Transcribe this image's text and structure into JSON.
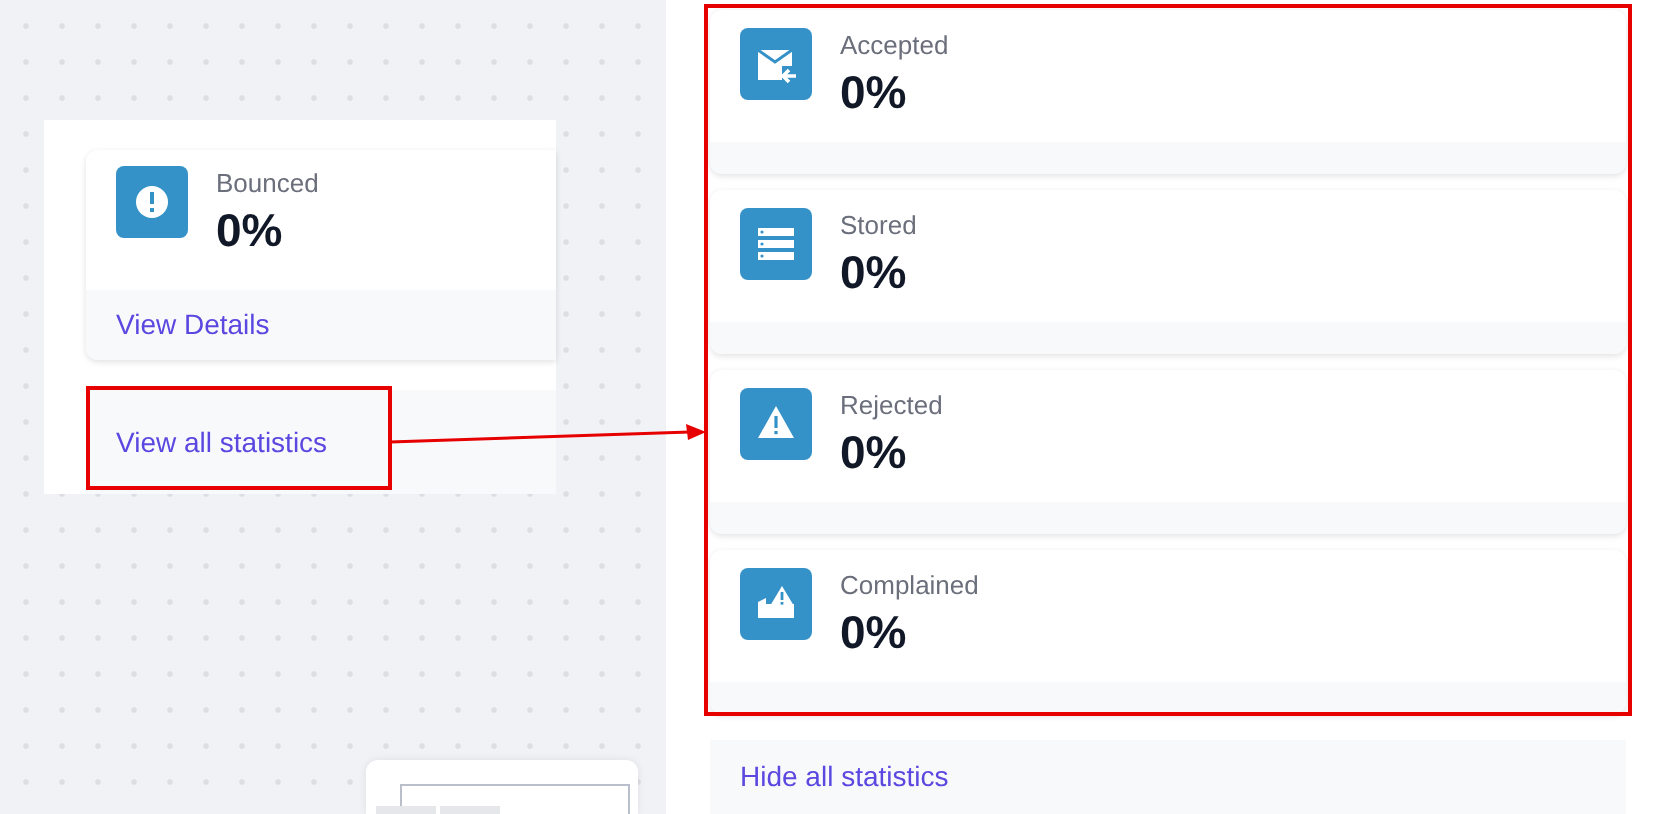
{
  "left_panel": {
    "card": {
      "kind": "bounced",
      "label": "Bounced",
      "value": "0%",
      "link": "View Details"
    },
    "link": "View all statistics"
  },
  "right_panel": {
    "cards": [
      {
        "kind": "accepted",
        "label": "Accepted",
        "value": "0%"
      },
      {
        "kind": "stored",
        "label": "Stored",
        "value": "0%"
      },
      {
        "kind": "rejected",
        "label": "Rejected",
        "value": "0%"
      },
      {
        "kind": "complained",
        "label": "Complained",
        "value": "0%"
      }
    ],
    "link": "Hide all statistics"
  }
}
